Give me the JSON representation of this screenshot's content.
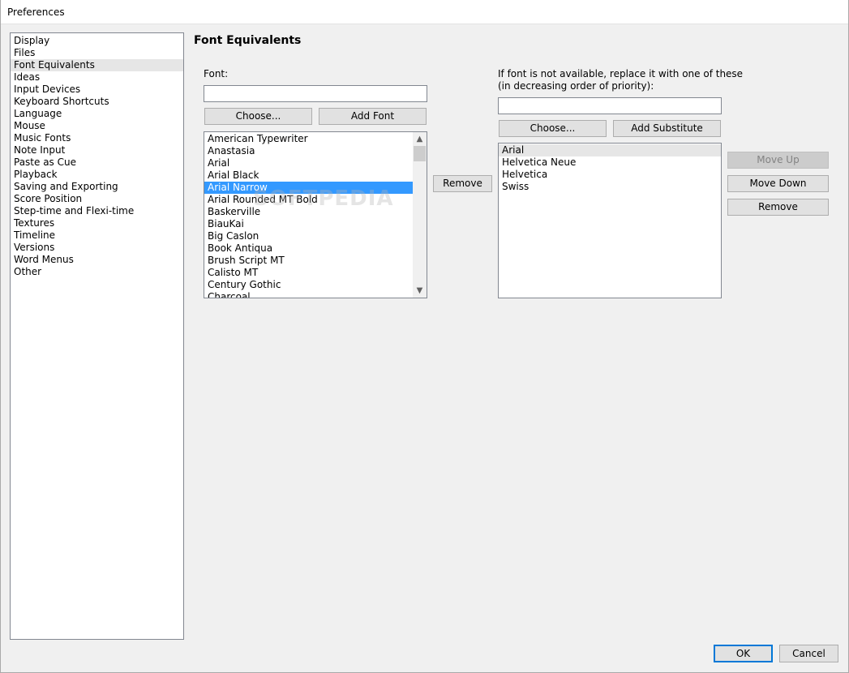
{
  "window": {
    "title": "Preferences"
  },
  "categories": [
    {
      "label": "Display"
    },
    {
      "label": "Files"
    },
    {
      "label": "Font Equivalents"
    },
    {
      "label": "Ideas"
    },
    {
      "label": "Input Devices"
    },
    {
      "label": "Keyboard Shortcuts"
    },
    {
      "label": "Language"
    },
    {
      "label": "Mouse"
    },
    {
      "label": "Music Fonts"
    },
    {
      "label": "Note Input"
    },
    {
      "label": "Paste as Cue"
    },
    {
      "label": "Playback"
    },
    {
      "label": "Saving and Exporting"
    },
    {
      "label": "Score Position"
    },
    {
      "label": "Step-time and Flexi-time"
    },
    {
      "label": "Textures"
    },
    {
      "label": "Timeline"
    },
    {
      "label": "Versions"
    },
    {
      "label": "Word Menus"
    },
    {
      "label": "Other"
    }
  ],
  "selected_category": "Font Equivalents",
  "page": {
    "heading": "Font Equivalents",
    "font_label": "Font:",
    "font_input_value": "",
    "choose_label": "Choose...",
    "add_font_label": "Add Font",
    "remove_label": "Remove",
    "fonts": [
      "American Typewriter",
      "Anastasia",
      "Arial",
      "Arial Black",
      "Arial Narrow",
      "Arial Rounded MT Bold",
      "Baskerville",
      "BiauKai",
      "Big Caslon",
      "Book Antiqua",
      "Brush Script MT",
      "Calisto MT",
      "Century Gothic",
      "Charcoal"
    ],
    "selected_font": "Arial Narrow",
    "substitute_label_line1": "If font is not available, replace it with one of these",
    "substitute_label_line2": "(in decreasing order of priority):",
    "substitute_input_value": "",
    "choose_sub_label": "Choose...",
    "add_substitute_label": "Add Substitute",
    "substitutes": [
      "Arial",
      "Helvetica Neue",
      "Helvetica",
      "Swiss"
    ],
    "selected_substitute": "Arial",
    "move_up_label": "Move Up",
    "move_down_label": "Move Down",
    "remove_sub_label": "Remove"
  },
  "footer": {
    "ok_label": "OK",
    "cancel_label": "Cancel"
  },
  "watermark_text": "SOFTPEDIA",
  "colors": {
    "selection": "#3399ff",
    "default_button_border": "#0078d7"
  }
}
